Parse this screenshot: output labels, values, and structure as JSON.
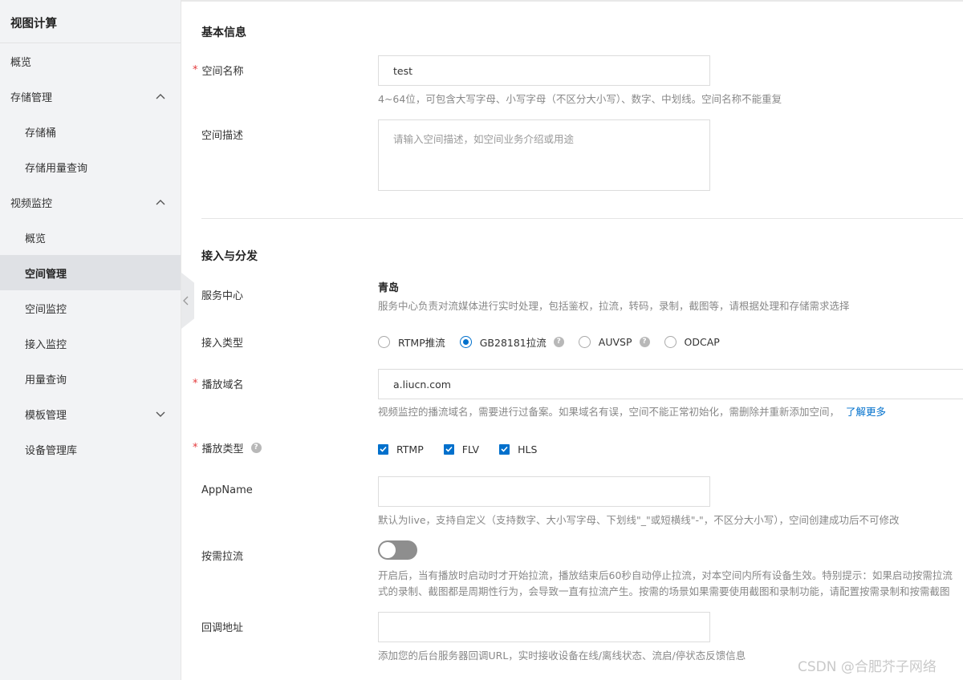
{
  "sidebar": {
    "title": "视图计算",
    "items": [
      {
        "label": "概览",
        "level": 1
      },
      {
        "label": "存储管理",
        "level": 1,
        "expanded": true
      },
      {
        "label": "存储桶",
        "level": 2
      },
      {
        "label": "存储用量查询",
        "level": 2
      },
      {
        "label": "视频监控",
        "level": 1,
        "expanded": true
      },
      {
        "label": "概览",
        "level": 2
      },
      {
        "label": "空间管理",
        "level": 2,
        "active": true
      },
      {
        "label": "空间监控",
        "level": 2
      },
      {
        "label": "接入监控",
        "level": 2
      },
      {
        "label": "用量查询",
        "level": 2
      },
      {
        "label": "模板管理",
        "level": 2,
        "expanded": false
      },
      {
        "label": "设备管理库",
        "level": 2
      }
    ]
  },
  "basic_info": {
    "section_title": "基本信息",
    "space_name": {
      "label": "空间名称",
      "value": "test",
      "hint": "4~64位，可包含大写字母、小写字母（不区分大小写）、数字、中划线。空间名称不能重复"
    },
    "space_desc": {
      "label": "空间描述",
      "placeholder": "请输入空间描述，如空间业务介绍或用途"
    }
  },
  "access": {
    "section_title": "接入与分发",
    "service_center": {
      "label": "服务中心",
      "value": "青岛",
      "hint": "服务中心负责对流媒体进行实时处理，包括鉴权，拉流，转码，录制，截图等，请根据处理和存储需求选择"
    },
    "access_type": {
      "label": "接入类型",
      "options": [
        "RTMP推流",
        "GB28181拉流",
        "AUVSP",
        "ODCAP"
      ],
      "selected": "GB28181拉流"
    },
    "play_domain": {
      "label": "播放域名",
      "value": "a.liucn.com",
      "hint": "视频监控的播流域名，需要进行过备案。如果域名有误，空间不能正常初始化，需删除并重新添加空间，",
      "link": "了解更多"
    },
    "play_type": {
      "label": "播放类型",
      "options": [
        "RTMP",
        "FLV",
        "HLS"
      ],
      "checked": [
        true,
        true,
        true
      ]
    },
    "app_name": {
      "label": "AppName",
      "value": "",
      "hint": "默认为live，支持自定义（支持数字、大小写字母、下划线\"_\"或短横线\"-\"，不区分大小写），空间创建成功后不可修改"
    },
    "on_demand": {
      "label": "按需拉流",
      "enabled": false,
      "hint_line1": "开启后，当有播放时启动时才开始拉流，播放结束后60秒自动停止拉流，对本空间内所有设备生效。特别提示：如果启动按需拉流",
      "hint_line2": "式的录制、截图都是周期性行为，会导致一直有拉流产生。按需的场景如果需要使用截图和录制功能，请配置按需录制和按需截图"
    },
    "callback": {
      "label": "回调地址",
      "value": "",
      "hint": "添加您的后台服务器回调URL，实时接收设备在线/离线状态、流启/停状态反馈信息"
    }
  },
  "watermark": "CSDN @合肥芥子网络",
  "colors": {
    "accent": "#0070cc",
    "required": "#e4393c",
    "brand": "#ff6a00"
  }
}
